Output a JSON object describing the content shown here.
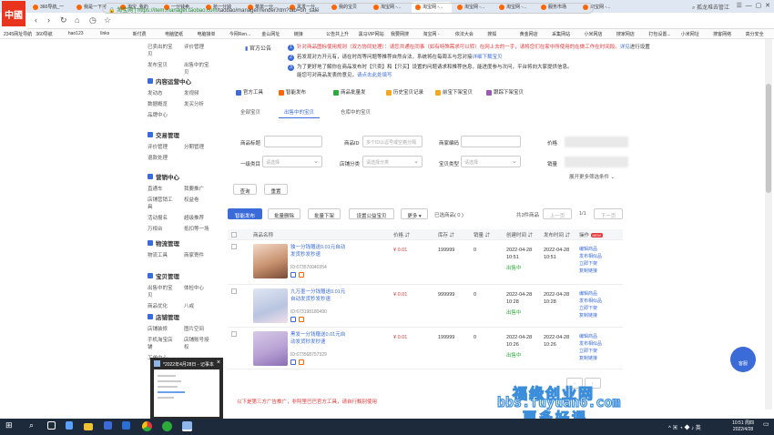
{
  "browser": {
    "logo_text": "中國",
    "tabs": [
      {
        "label": "360导航_一"
      },
      {
        "label": "我是一下可"
      },
      {
        "label": "淘宝_我的"
      },
      {
        "label": "一分钱卖..."
      },
      {
        "label": "抢一分钱"
      },
      {
        "label": "菜单一分..."
      },
      {
        "label": "黑发一分..."
      },
      {
        "label": "我的宝贝"
      },
      {
        "label": "淘宝网 -..."
      },
      {
        "label": "淘宝网 -..."
      },
      {
        "label": "淘宝网 -..."
      },
      {
        "label": "淘宝网 -..."
      },
      {
        "label": "服务市场"
      },
      {
        "label": "淘宝网 -..."
      }
    ],
    "url_secure_label": "淘宝网",
    "url_host": "https://item.manager.taobao.com",
    "url_path": "/taobao/manager/render.htm?tab=on_sale",
    "search_text": "孤龙堆去管江",
    "bookmarks": [
      "2345网址导航",
      "360导航",
      "hao123",
      "links",
      "新付费",
      "电脑壁纸",
      "电脑接单",
      "今网Ren...",
      "金山网址",
      "链接",
      "公告共上升",
      "黑马VIP网站",
      "我要网搜",
      "淘宝网 -",
      "依法大会",
      "搜狐",
      "黄金网店",
      "采集网站",
      "小米网店",
      "搜家网店",
      "打包设置...",
      "小米网址",
      "搜客网络",
      "高分安全"
    ]
  },
  "notice": {
    "label": "官方公告",
    "line1_prefix": "针对商品图标使用规则（双方协同处理）：",
    "line1_red": "请您共通在同事（如有特殊需求可以转）在网上去的一手，请将您们在家中所使用的在做工作在时间段。",
    "line1_blue": "详见",
    "line1_suffix": "进行设置",
    "line2": "若发现对方开元有，请在时尚等问题等推荐自然合法，系统将在每周五与您对接",
    "line2_blue": "详细下载宝贝",
    "line3": "为了更好地了解你在商品发布时【只卖】和【只买】设置的问题请求和推荐信息，能进度参与次问，平台将向大家提供信息。",
    "line3_b": "能您可对商品发表的意见，",
    "line3_blue": "请点击此处填写"
  },
  "tools": {
    "label": "官方工具",
    "items": [
      "智能发布",
      "商品批量发",
      "历史宝贝记录",
      "前宝下架宝贝",
      "跟踪下架宝贝"
    ]
  },
  "subtabs": [
    "全部宝贝",
    "出售中的宝贝",
    "仓库中的宝贝"
  ],
  "filters": {
    "title_label": "商品标题",
    "id_label": "商品ID",
    "id_placeholder": "多个ID以逗号或空格分隔",
    "code_label": "商家编码",
    "price_label": "价格",
    "cat_label": "一级类目",
    "cat_placeholder": "请选择",
    "shopcat_label": "店铺分类",
    "shopcat_placeholder": "请选择分类",
    "type_label": "宝贝类型",
    "type_placeholder": "请选择",
    "sales_label": "销量",
    "expand_label": "展开更多筛选条件",
    "query_btn": "查询",
    "reset_btn": "重置"
  },
  "actions": {
    "publish": "智能发布",
    "batch_delete": "批量删除",
    "batch_off": "批量下架",
    "set_welfare": "设置公益宝贝",
    "more": "更多",
    "selected": "已选商品( 0 )",
    "total": "共3件商品",
    "prev": "上一页",
    "page": "1/1",
    "next": "下一页"
  },
  "table": {
    "headers": [
      "商品名称",
      "价格",
      "库存",
      "销量",
      "创建时间",
      "发布时间",
      "操作"
    ],
    "new_badge": "NEW",
    "rows": [
      {
        "name": "独一分钱赠送0.01元自动发货秒发秒速",
        "id": "ID:673570040354",
        "price": "¥ 0.01",
        "stock": "199999",
        "sales": "0",
        "created_date": "2022-04-28",
        "created_time": "10:51",
        "published_date": "2022-04-28",
        "published_time": "10:51",
        "status": "出售中",
        "ops": [
          "编辑商品",
          "发布相似品",
          "立即下架",
          "复制链接"
        ]
      },
      {
        "name": "九万墨一分钱赠送0.01元自动发货秒发秒速",
        "id": "ID:673198180490",
        "price": "¥ 0.01",
        "stock": "999999",
        "sales": "0",
        "created_date": "2022-04-28",
        "created_time": "10:28",
        "published_date": "2022-04-28",
        "published_time": "10:28",
        "status": "出售中",
        "ops": [
          "编辑商品",
          "发布相似品",
          "立即下架",
          "复制链接"
        ]
      },
      {
        "name": "黑发一分钱赠送0.01元自动发货秒发秒速",
        "id": "ID:673568757329",
        "price": "¥ 0.01",
        "stock": "199999",
        "sales": "0",
        "created_date": "2022-04-28",
        "created_time": "10:26",
        "published_date": "2022-04-28",
        "published_time": "10:26",
        "status": "出售中",
        "ops": [
          "编辑商品",
          "发布相似品",
          "立即下架",
          "复制链接"
        ]
      }
    ]
  },
  "leftnav": {
    "groups": [
      {
        "title": "",
        "rows": [
          [
            "已卖出的宝贝",
            "评价管理"
          ],
          [
            "发布宝贝",
            "出售中的宝贝"
          ]
        ]
      },
      {
        "title": "内容运营中心",
        "rows": [
          [
            "发动态",
            "发视频"
          ],
          [
            "数据概览",
            "发买分析"
          ],
          [
            "品牌中心",
            ""
          ]
        ]
      },
      {
        "title": "交易管理",
        "rows": [
          [
            "评价管理",
            "分期管理"
          ],
          [
            "退款处理",
            ""
          ]
        ]
      },
      {
        "title": "营销中心",
        "rows": [
          [
            "直通车",
            "我要推广"
          ],
          [
            "店铺营销工具",
            "权益卷"
          ],
          [
            "活动报名",
            "超级推荐"
          ],
          [
            "万相台",
            "抵扣等一场"
          ]
        ]
      },
      {
        "title": "物流管理",
        "rows": [
          [
            "物流工具",
            "商家寄件"
          ]
        ]
      },
      {
        "title": "宝贝管理",
        "rows": [
          [
            "出售中的宝贝",
            "体检中心"
          ],
          [
            "商品优化",
            "八戒"
          ]
        ]
      },
      {
        "title": "店铺管理",
        "rows": [
          [
            "店铺装修",
            "图片空间"
          ],
          [
            "手机淘宝店铺",
            "店铺账号授权"
          ],
          [
            "工单中心",
            ""
          ]
        ]
      }
    ]
  },
  "notepad": {
    "title": "*2022年4月28日 - 记事本"
  },
  "help_label": "客服",
  "bottom_notice": "以下是第三方广告推广，非阿里巴巴官方工具，请自行甄别使用",
  "watermark": {
    "line1": "福缘创业网",
    "line2": "bbs.fuyuan6.com",
    "line3": "更多好课"
  },
  "taskbar": {
    "time": "10:51 周四",
    "date": "2022/4/28"
  }
}
